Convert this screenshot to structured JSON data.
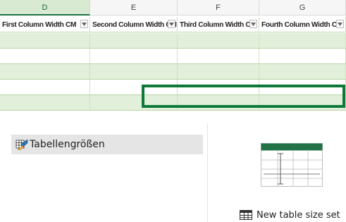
{
  "sheet": {
    "column_letters": [
      "D",
      "E",
      "F",
      "G"
    ],
    "active_letter": "D",
    "headers": [
      "First Column Width CM",
      "Second Column Width CM",
      "Third Column Width CM",
      "Fourth Column Width CM"
    ],
    "row_bands": [
      "band",
      "plain",
      "band",
      "plain",
      "band"
    ],
    "accent_color": "#217346",
    "band_color": "#e2efda"
  },
  "panel": {
    "list_items": [
      {
        "label": "Tabellengrößen",
        "icon": "ruler-table-icon",
        "selected": true
      }
    ],
    "preview_icon": "table-preview-icon",
    "new_set": {
      "label": "New table size set",
      "icon": "table-grid-icon"
    }
  }
}
